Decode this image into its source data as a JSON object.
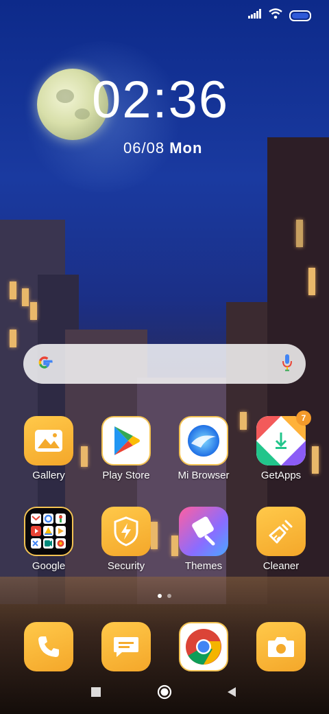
{
  "clock": {
    "time": "02:36",
    "date": "06/08",
    "day": "Mon"
  },
  "apps_row1": [
    {
      "label": "Gallery"
    },
    {
      "label": "Play Store"
    },
    {
      "label": "Mi Browser"
    },
    {
      "label": "GetApps",
      "badge": "7"
    }
  ],
  "apps_row2": [
    {
      "label": "Google"
    },
    {
      "label": "Security"
    },
    {
      "label": "Themes"
    },
    {
      "label": "Cleaner"
    }
  ],
  "dock": [
    "phone-icon",
    "messages-icon",
    "chrome-icon",
    "camera-icon"
  ],
  "colors": {
    "accent_orange": "#f7b531",
    "badge": "#f39a2a"
  }
}
